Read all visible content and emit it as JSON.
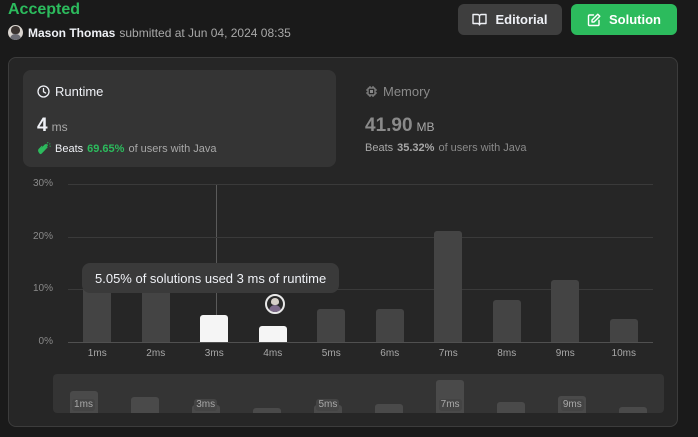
{
  "submission": {
    "status": "Accepted",
    "username": "Mason Thomas",
    "submitted_text": "submitted at Jun 04, 2024 08:35"
  },
  "buttons": {
    "editorial": "Editorial",
    "solution": "Solution"
  },
  "runtime": {
    "title": "Runtime",
    "value": "4",
    "unit": "ms",
    "beats_label": "Beats",
    "beats_pct": "69.65%",
    "beats_suffix": "of users with Java"
  },
  "memory": {
    "title": "Memory",
    "value": "41.90",
    "unit": "MB",
    "beats_label": "Beats",
    "beats_pct": "35.32%",
    "beats_suffix": "of users with Java"
  },
  "tooltip": "5.05% of solutions used 3 ms of runtime",
  "colors": {
    "accent": "#2cbb5d",
    "bar": "#444444",
    "bar_highlight": "#f5f5f5"
  },
  "chart_data": {
    "type": "bar",
    "y_ticks": [
      "30%",
      "20%",
      "10%",
      "0%"
    ],
    "ylim": [
      0,
      30
    ],
    "categories": [
      "1ms",
      "2ms",
      "3ms",
      "4ms",
      "5ms",
      "6ms",
      "7ms",
      "8ms",
      "9ms",
      "10ms"
    ],
    "values": [
      10.5,
      10.5,
      5.05,
      3.0,
      6.3,
      6.3,
      21.0,
      8.0,
      11.8,
      4.4
    ],
    "highlighted": [
      "3ms",
      "4ms"
    ],
    "overview": {
      "values": [
        2.5,
        1.9,
        0.9,
        0.6,
        0.9,
        1.0,
        3.8,
        1.3,
        2.0,
        0.7
      ],
      "labels": [
        "1ms",
        "",
        "3ms",
        "",
        "5ms",
        "",
        "7ms",
        "",
        "9ms",
        ""
      ]
    }
  }
}
